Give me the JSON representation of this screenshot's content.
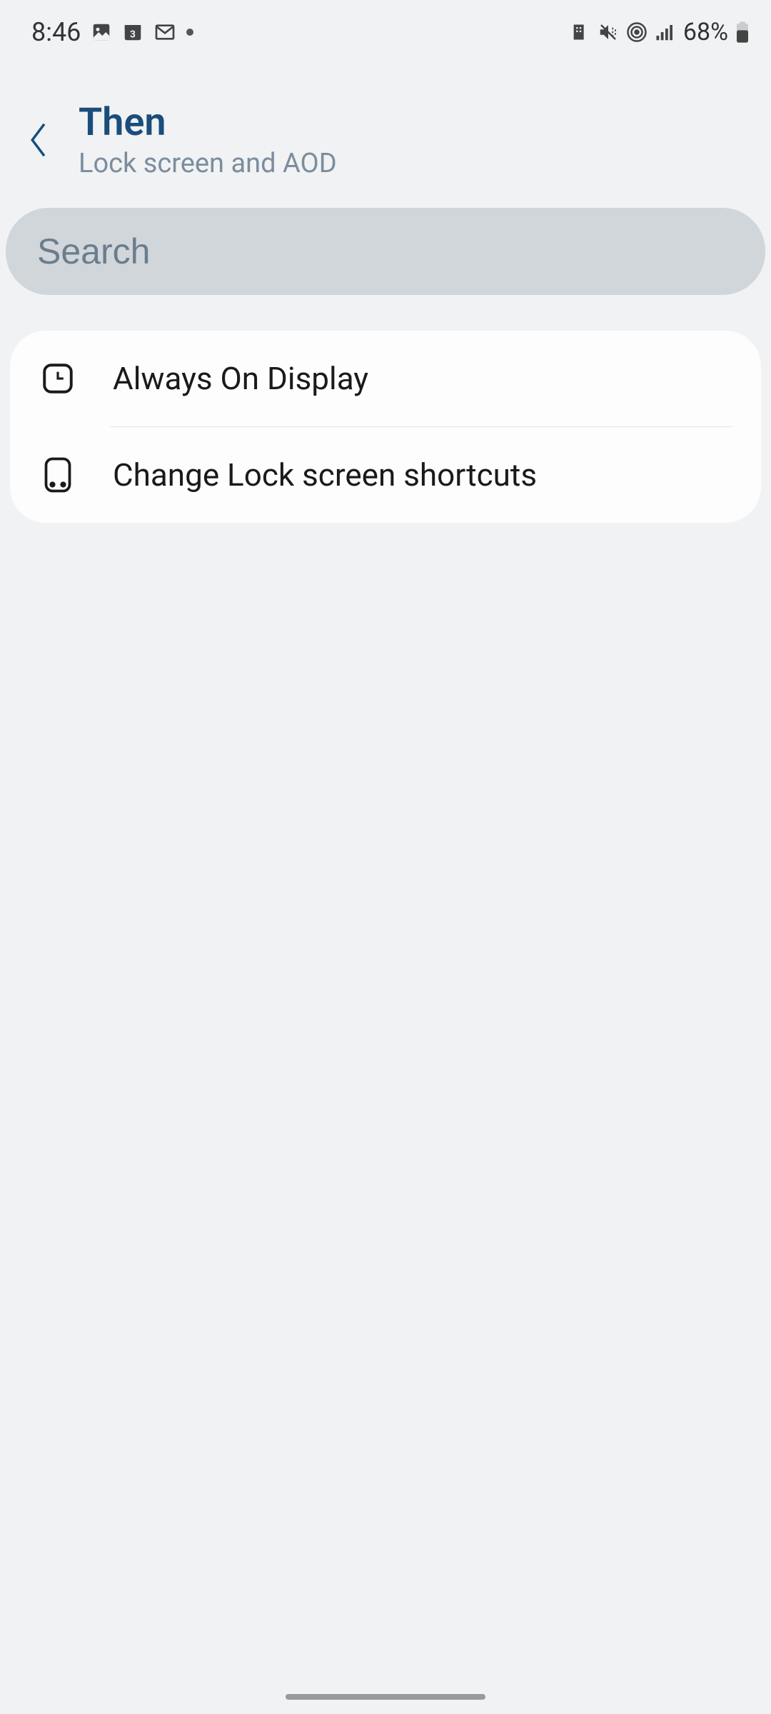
{
  "statusBar": {
    "time": "8:46",
    "battery": "68%"
  },
  "header": {
    "title": "Then",
    "subtitle": "Lock screen and AOD"
  },
  "search": {
    "placeholder": "Search"
  },
  "list": {
    "items": [
      {
        "label": "Always On Display"
      },
      {
        "label": "Change Lock screen shortcuts"
      }
    ]
  }
}
